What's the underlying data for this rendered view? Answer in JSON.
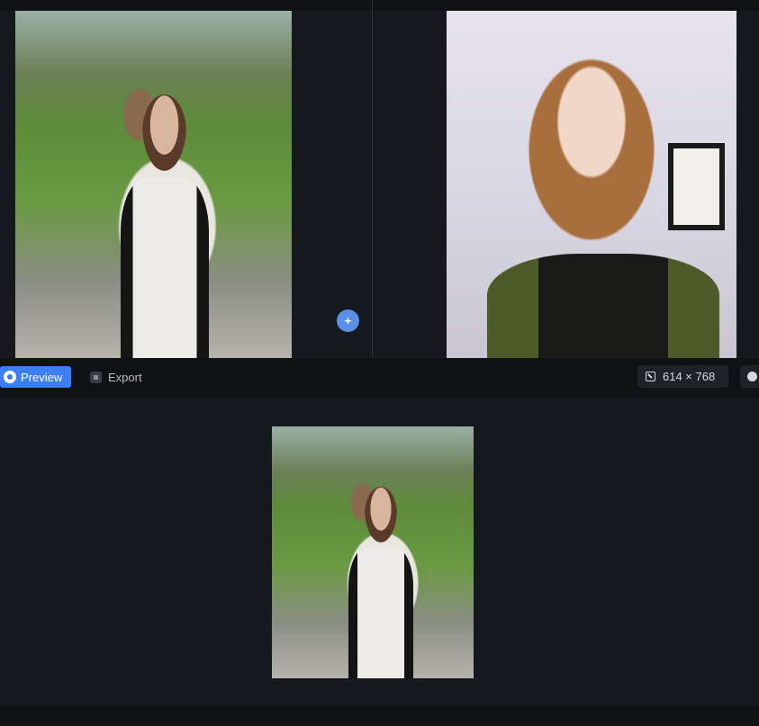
{
  "toolbar": {
    "preview_label": "Preview",
    "export_label": "Export",
    "dimensions": "614 × 768"
  },
  "add_button": {
    "label": "+"
  },
  "icons": {
    "preview": "eye-icon",
    "export": "export-icon",
    "dimensions": "resize-icon",
    "info": "info-icon",
    "add": "plus-icon"
  },
  "colors": {
    "accent": "#3b7ff2",
    "add_button": "#5b8fe6",
    "background": "#15181d",
    "toolbar": "#0f1114"
  }
}
